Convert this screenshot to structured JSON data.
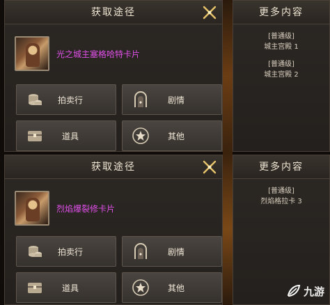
{
  "colors": {
    "panel_bg": "#2a2622",
    "item_name": "#e050e8",
    "accent_gold": "#d8b35a"
  },
  "blocks": [
    {
      "header_title": "获取途径",
      "item_name": "光之城主塞格哈特卡片",
      "buttons": [
        {
          "label": "拍卖行",
          "icon": "coins-icon"
        },
        {
          "label": "剧情",
          "icon": "doorway-icon"
        },
        {
          "label": "道具",
          "icon": "chest-icon"
        },
        {
          "label": "其他",
          "icon": "star-icon"
        }
      ],
      "more_title": "更多内容",
      "more_items": [
        {
          "tag": "[普通级]",
          "name": "城主宫殿 1"
        },
        {
          "tag": "[普通级]",
          "name": "城主宫殿 2"
        }
      ]
    },
    {
      "header_title": "获取途径",
      "item_name": "烈焰爆裂修卡片",
      "buttons": [
        {
          "label": "拍卖行",
          "icon": "coins-icon"
        },
        {
          "label": "剧情",
          "icon": "doorway-icon"
        },
        {
          "label": "道具",
          "icon": "chest-icon"
        },
        {
          "label": "其他",
          "icon": "star-icon"
        }
      ],
      "more_title": "更多内容",
      "more_items": [
        {
          "tag": "[普通级]",
          "name": "烈焰格拉卡 3"
        }
      ]
    }
  ],
  "watermark": {
    "text": "九游",
    "icon": "leaf-logo-icon"
  }
}
